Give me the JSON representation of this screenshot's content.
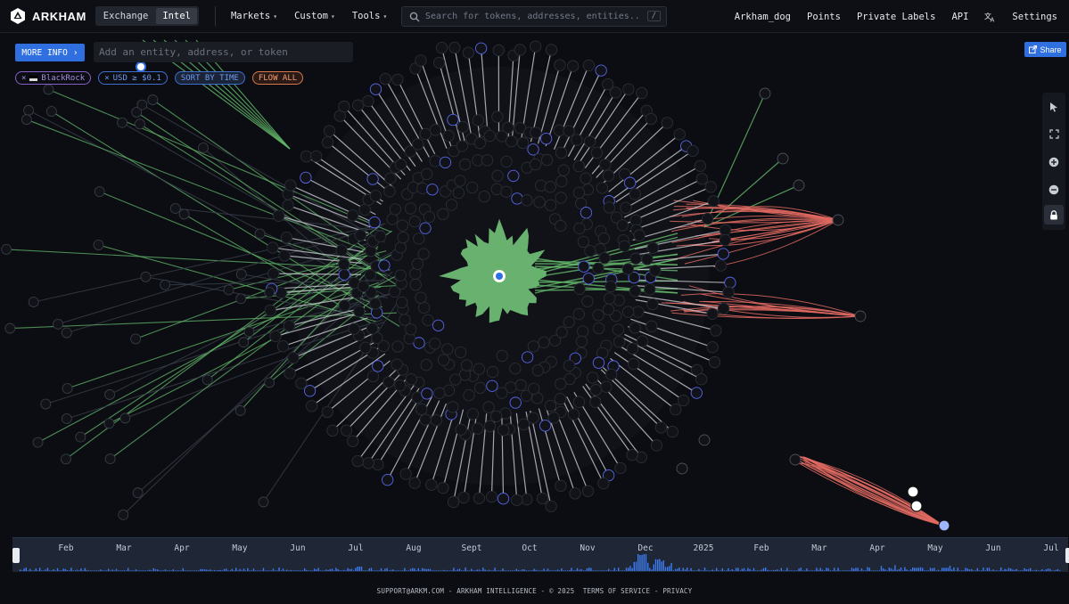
{
  "app": {
    "name": "ARKHAM"
  },
  "modes": [
    {
      "label": "Exchange",
      "active": false
    },
    {
      "label": "Intel",
      "active": true
    }
  ],
  "menu": [
    {
      "label": "Markets"
    },
    {
      "label": "Custom"
    },
    {
      "label": "Tools"
    }
  ],
  "search": {
    "placeholder": "Search for tokens, addresses, entities...",
    "shortcut": "/"
  },
  "user_menu": [
    "Arkham_dog",
    "Points",
    "Private Labels",
    "API"
  ],
  "settings_label": "Settings",
  "graph": {
    "more_info_label": "MORE INFO",
    "entity_input_placeholder": "Add an entity, address, or token",
    "filters": {
      "entity": "BlackRock",
      "usd": "USD ≥ $0.1",
      "sort": "SORT BY TIME",
      "flow": "FLOW ALL"
    },
    "share_label": "Share",
    "tools": [
      "cursor-icon",
      "fit-view-icon",
      "zoom-in-icon",
      "zoom-out-icon",
      "lock-icon"
    ],
    "colors": {
      "inflow": "#63b86a",
      "outflow": "#e06a62",
      "node": "#111318",
      "node_ring": "#5865e8",
      "center": "#2f6fe0"
    }
  },
  "timeline": {
    "months": [
      "Feb",
      "Mar",
      "Apr",
      "May",
      "Jun",
      "Jul",
      "Aug",
      "Sept",
      "Oct",
      "Nov",
      "Dec",
      "2025",
      "Feb",
      "Mar",
      "Apr",
      "May",
      "Jun",
      "Jul"
    ],
    "bar_color": "#3d7cf0"
  },
  "footer": {
    "email": "SUPPORT@ARKM.COM",
    "company": "ARKHAM INTELLIGENCE",
    "copyright": "© 2025",
    "terms": "TERMS OF SERVICE",
    "privacy": "PRIVACY",
    "separator": " - "
  }
}
